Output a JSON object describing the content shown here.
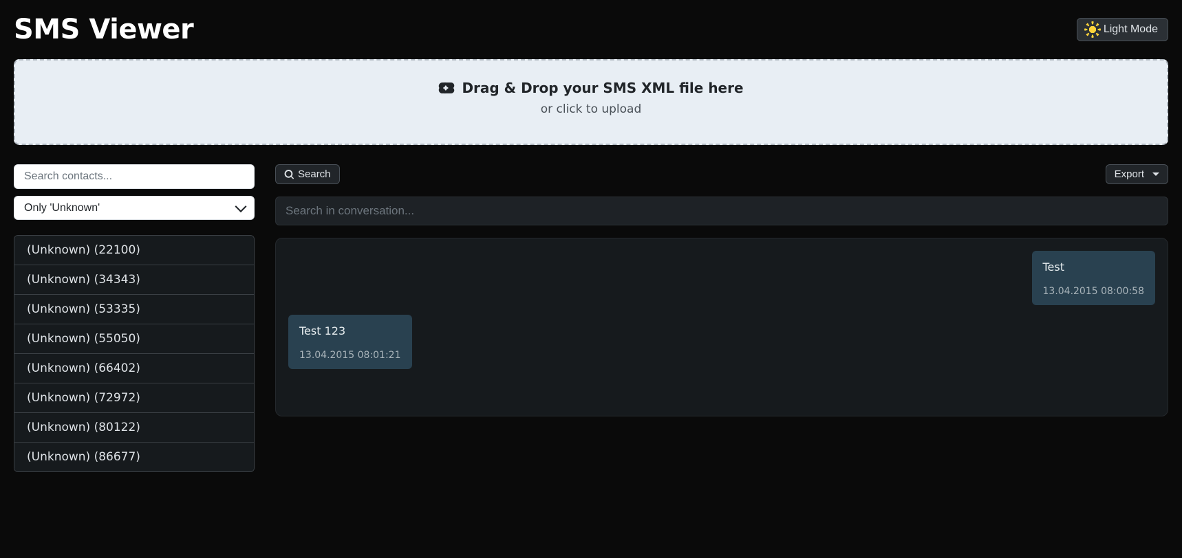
{
  "header": {
    "title": "SMS Viewer",
    "theme_button": "Light Mode"
  },
  "dropzone": {
    "title": "Drag & Drop your SMS XML file here",
    "subtitle": "or click to upload"
  },
  "sidebar": {
    "search_placeholder": "Search contacts...",
    "filter_value": "Only 'Unknown'",
    "contacts": [
      "(Unknown) (22100)",
      "(Unknown) (34343)",
      "(Unknown) (53335)",
      "(Unknown) (55050)",
      "(Unknown) (66402)",
      "(Unknown) (72972)",
      "(Unknown) (80122)",
      "(Unknown) (86677)"
    ]
  },
  "toolbar": {
    "search_button": "Search",
    "export_button": "Export"
  },
  "conversation": {
    "search_placeholder": "Search in conversation...",
    "messages": [
      {
        "side": "right",
        "body": "Test",
        "time": "13.04.2015 08:00:58"
      },
      {
        "side": "left",
        "body": "Test 123",
        "time": "13.04.2015 08:01:21"
      }
    ]
  }
}
